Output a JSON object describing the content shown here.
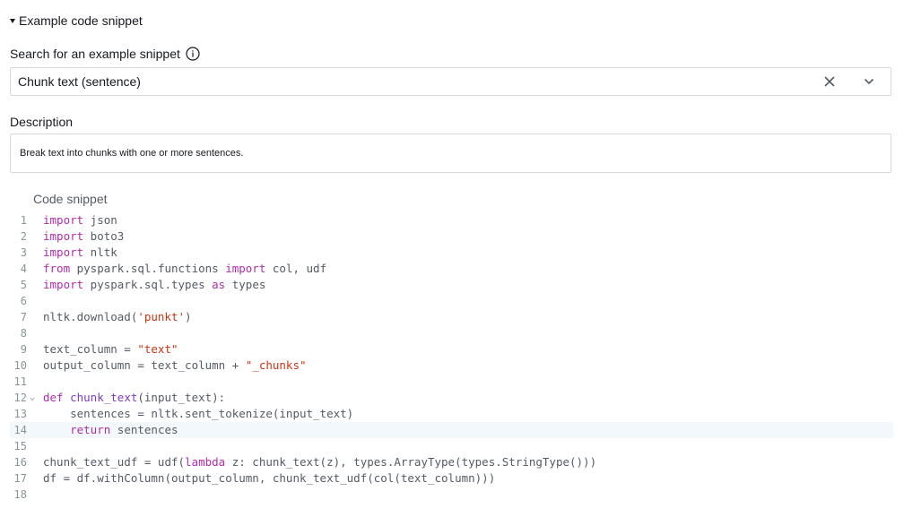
{
  "expander": {
    "label": "Example code snippet"
  },
  "search": {
    "label": "Search for an example snippet",
    "selected": "Chunk text (sentence)"
  },
  "description": {
    "label": "Description",
    "text": "Break text into chunks with one or more sentences."
  },
  "code": {
    "label": "Code snippet",
    "lines": [
      "import json",
      "import boto3",
      "import nltk",
      "from pyspark.sql.functions import col, udf",
      "import pyspark.sql.types as types",
      "",
      "nltk.download('punkt')",
      "",
      "text_column = \"text\"",
      "output_column = text_column + \"_chunks\"",
      "",
      "def chunk_text(input_text):",
      "    sentences = nltk.sent_tokenize(input_text)",
      "    return sentences",
      "",
      "chunk_text_udf = udf(lambda z: chunk_text(z), types.ArrayType(types.StringType()))",
      "df = df.withColumn(output_column, chunk_text_udf(col(text_column)))",
      ""
    ],
    "active_line": 14,
    "fold_line": 12
  }
}
